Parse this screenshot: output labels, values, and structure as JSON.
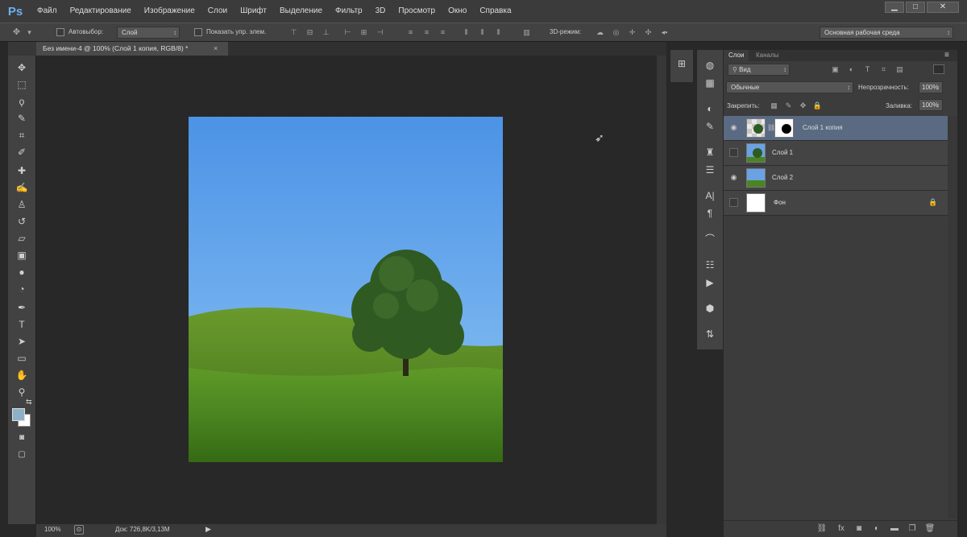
{
  "app": {
    "logo": "Ps"
  },
  "menu": [
    "Файл",
    "Редактирование",
    "Изображение",
    "Слои",
    "Шрифт",
    "Выделение",
    "Фильтр",
    "3D",
    "Просмотр",
    "Окно",
    "Справка"
  ],
  "window_controls": {
    "minimize": "▁",
    "maximize": "□",
    "close": "✕"
  },
  "options": {
    "autoselect_label": "Автовыбор:",
    "autoselect_value": "Слой",
    "show_transform_label": "Показать упр. элем.",
    "mode_3d_label": "3D-режим:",
    "workspace": "Основная рабочая среда"
  },
  "document": {
    "tab_title": "Без имени-4 @ 100% (Слой 1 копия, RGB/8) *",
    "tab_close": "×",
    "zoom": "100%",
    "doc_info": "Док: 726,8K/3,13M"
  },
  "layers_panel": {
    "tab_layers": "Слои",
    "tab_channels": "Каналы",
    "filter_kind": "Вид",
    "blend_mode": "Обычные",
    "opacity_label": "Непрозрачность:",
    "opacity_value": "100%",
    "lock_label": "Закрепить:",
    "fill_label": "Заливка:",
    "fill_value": "100%",
    "layers": [
      {
        "name": "Слой 1 копия",
        "visible": true,
        "selected": true
      },
      {
        "name": "Слой 1",
        "visible": false,
        "selected": false
      },
      {
        "name": "Слой 2",
        "visible": true,
        "selected": false
      },
      {
        "name": "Фон",
        "visible": false,
        "locked": true,
        "selected": false
      }
    ]
  },
  "colors": {
    "ps_blue": "#6ab0f0",
    "selected_layer": "#5a6a82",
    "foreground": "#8fb1c8",
    "background": "#ffffff"
  }
}
